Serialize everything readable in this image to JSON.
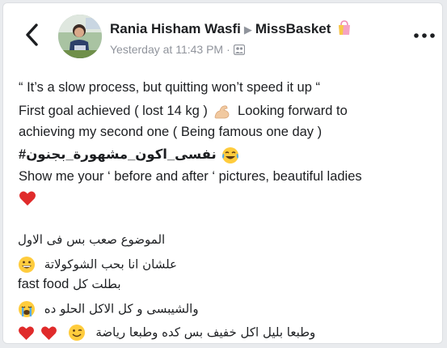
{
  "post": {
    "author": "Rania Hisham Wasfi",
    "group": "MissBasket",
    "timestamp": "Yesterday at 11:43 PM",
    "privacy_icon": "group-audience-icon",
    "lines": {
      "l1": "“ It’s a slow process, but quitting won’t speed it up “",
      "l2": "First goal achieved ( lost 14 kg )",
      "l2b": "Looking forward to",
      "l3": "achieving my second one ( Being famous one day )",
      "hashtag": "#نفسى_اكون_مشهورة_بجنون",
      "l5": "Show me your ‘ before and after ‘ pictures, beautiful ladies"
    },
    "arabic": {
      "a1": "الموضوع صعب بس فى الاول",
      "a2": "علشان انا بحب الشوكولاتة",
      "a3_ar": "بطلت كل",
      "a3_en": "fast food",
      "a4": "والشيبسى و كل الاكل الحلو ده",
      "a5": "وطبعا بليل اكل خفيف بس كده وطبعا رياضة"
    }
  },
  "colors": {
    "text": "#1c1e21",
    "secondary": "#90949c",
    "heart": "#e02b2b",
    "emoji_yellow": "#ffcc3d"
  }
}
